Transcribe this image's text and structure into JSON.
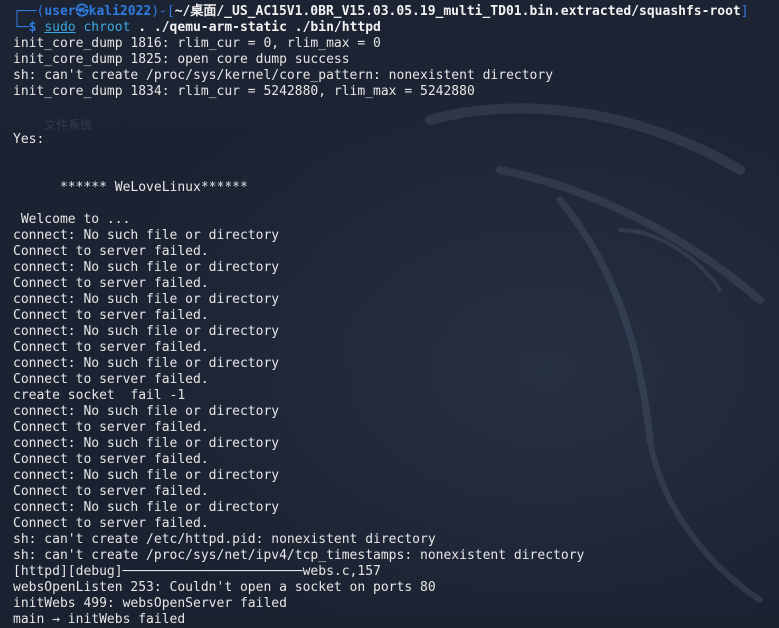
{
  "prompt": {
    "open": "┌──(",
    "user_host": "user㉿kali2022",
    "close_user": ")-[",
    "cwd": "~/桌面/_US_AC15V1.0BR_V15.03.05.19_multi_TD01.bin.extracted/squashfs-root",
    "close_cwd": "]",
    "line2_prefix": "└─",
    "dollar": "$",
    "cmd_sudo": "sudo",
    "cmd_chroot": "chroot",
    "cmd_args": ". ./qemu-arm-static ./bin/httpd"
  },
  "output": {
    "l01": "init_core_dump 1816: rlim_cur = 0, rlim_max = 0",
    "l02": "init_core_dump 1825: open core dump success",
    "l03": "sh: can't create /proc/sys/kernel/core_pattern: nonexistent directory",
    "l04": "init_core_dump 1834: rlim_cur = 5242880, rlim_max = 5242880",
    "l05": "",
    "l06": "",
    "l07": "Yes:",
    "l08": "",
    "l09": "",
    "l10": "      ****** WeLoveLinux******",
    "l11": "",
    "l12": " Welcome to ...",
    "l13": "connect: No such file or directory",
    "l14": "Connect to server failed.",
    "l15": "connect: No such file or directory",
    "l16": "Connect to server failed.",
    "l17": "connect: No such file or directory",
    "l18": "Connect to server failed.",
    "l19": "connect: No such file or directory",
    "l20": "Connect to server failed.",
    "l21": "connect: No such file or directory",
    "l22": "Connect to server failed.",
    "l23": "create socket  fail -1",
    "l24": "connect: No such file or directory",
    "l25": "Connect to server failed.",
    "l26": "connect: No such file or directory",
    "l27": "Connect to server failed.",
    "l28": "connect: No such file or directory",
    "l29": "Connect to server failed.",
    "l30": "connect: No such file or directory",
    "l31": "Connect to server failed.",
    "l32": "sh: can't create /etc/httpd.pid: nonexistent directory",
    "l33": "sh: can't create /proc/sys/net/ipv4/tcp_timestamps: nonexistent directory",
    "l34": "[httpd][debug]───────────────────────webs.c,157",
    "l35": "websOpenListen 253: Couldn't open a socket on ports 80",
    "l36": "initWebs 499: websOpenServer failed",
    "l37": "main → initWebs failed"
  },
  "ghost": {
    "text": "文件系统"
  },
  "colors": {
    "background": "#1b2230",
    "prompt_blue": "#2f7ce0",
    "command_cyan": "#3aa9e0",
    "text": "#e6e6e6"
  }
}
